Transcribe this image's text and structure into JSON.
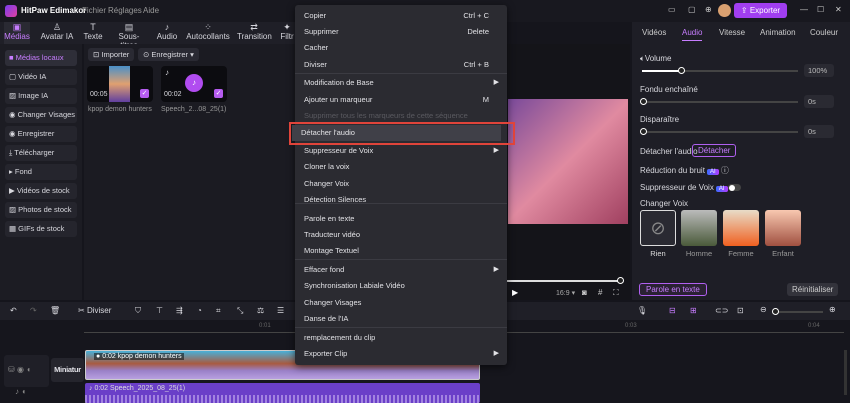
{
  "app": {
    "title": "HitPaw Edimakor",
    "menus": [
      "Fichier",
      "Réglages",
      "Aide"
    ],
    "export_label": "Exporter",
    "accent": "#a13ef0"
  },
  "toolbar": [
    "Médias",
    "Avatar IA",
    "Texte",
    "Sous-titres",
    "Audio",
    "Autocollants",
    "Transition",
    "Filtr"
  ],
  "sidebar": [
    "Médias locaux",
    "Vidéo IA",
    "Image IA",
    "Changer Visages",
    "Enregistrer",
    "Télécharger",
    "Fond",
    "Vidéos de stock",
    "Photos de stock",
    "GIFs de stock"
  ],
  "media": {
    "import_label": "Importer",
    "record_label": "Enregistrer",
    "items": [
      {
        "name": "kpop demon hunters",
        "duration": "00:05"
      },
      {
        "name": "Speech_2...08_25(1)",
        "duration": "00:02"
      }
    ]
  },
  "preview": {
    "ratio": "16:9"
  },
  "right": {
    "tabs": [
      "Vidéos",
      "Audio",
      "Vitesse",
      "Animation",
      "Couleur"
    ],
    "active_tab": "Audio",
    "volume_label": "Volume",
    "volume_value": "100%",
    "volume_level": 0.25,
    "fade_in_label": "Fondu enchaîné",
    "fade_in_value": "0s",
    "fade_out_label": "Disparaître",
    "fade_out_value": "0s",
    "detach_label": "Détacher l'audio",
    "detach_button": "Détacher",
    "noise_label": "Réduction du bruit",
    "ai_badge": "AI",
    "voice_sup_label": "Suppresseur de Voix",
    "change_voice_label": "Changer Voix",
    "voices": [
      "Rien",
      "Homme",
      "Femme",
      "Enfant"
    ],
    "speech_text_button": "Parole en texte",
    "reset_button": "Réinitialiser"
  },
  "timeline": {
    "split_label": "Diviser",
    "ticks": [
      "0:01",
      "0:03",
      "0:04"
    ],
    "cover_label": "Miniatur",
    "video_clip": "0:02 kpop demon hunters",
    "audio_clip": "0:02 Speech_2025_08_25(1)"
  },
  "context_menu": [
    {
      "label": "Copier",
      "shortcut": "Ctrl + C"
    },
    {
      "label": "Supprimer",
      "shortcut": "Delete"
    },
    {
      "label": "Cacher"
    },
    {
      "label": "Diviser",
      "shortcut": "Ctrl + B"
    },
    {
      "label": "Modification de Base",
      "submenu": true
    },
    {
      "label": "Ajouter un marqueur",
      "shortcut": "M"
    },
    {
      "label": "Supprimer tous les marqueurs de cette séquence",
      "disabled": true
    },
    {
      "label": "Détacher l'audio",
      "highlighted": true
    },
    {
      "label": "Suppresseur de Voix",
      "submenu": true
    },
    {
      "label": "Cloner la voix"
    },
    {
      "label": "Changer Voix"
    },
    {
      "label": "Détection Silences"
    },
    {
      "label": "Parole en texte"
    },
    {
      "label": "Traducteur vidéo"
    },
    {
      "label": "Montage Textuel"
    },
    {
      "label": "Effacer fond",
      "submenu": true
    },
    {
      "label": "Synchronisation Labiale Vidéo"
    },
    {
      "label": "Changer Visages"
    },
    {
      "label": "Danse de l'IA"
    },
    {
      "label": "remplacement du clip"
    },
    {
      "label": "Exporter Clip",
      "submenu": true
    }
  ]
}
